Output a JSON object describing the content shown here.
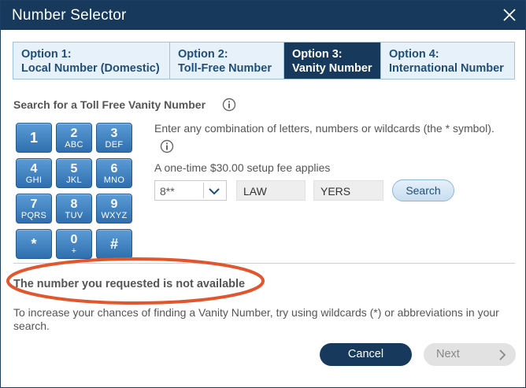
{
  "window": {
    "title": "Number Selector"
  },
  "tabs": [
    {
      "line1": "Option 1:",
      "line2": "Local Number (Domestic)",
      "active": false
    },
    {
      "line1": "Option 2:",
      "line2": "Toll-Free Number",
      "active": false
    },
    {
      "line1": "Option 3:",
      "line2": "Vanity Number",
      "active": true
    },
    {
      "line1": "Option 4:",
      "line2": "International Number",
      "active": false
    }
  ],
  "search": {
    "heading": "Search for a Toll Free Vanity Number",
    "instructions": "Enter any combination of letters, numbers or wildcards (the * symbol).",
    "fee": "A one-time $30.00 setup fee applies",
    "prefix_value": "8**",
    "field1_value": "LAW",
    "field2_value": "YERS",
    "button_label": "Search"
  },
  "keypad": [
    {
      "digit": "1",
      "letters": ""
    },
    {
      "digit": "2",
      "letters": "ABC"
    },
    {
      "digit": "3",
      "letters": "DEF"
    },
    {
      "digit": "4",
      "letters": "GHI"
    },
    {
      "digit": "5",
      "letters": "JKL"
    },
    {
      "digit": "6",
      "letters": "MNO"
    },
    {
      "digit": "7",
      "letters": "PQRS"
    },
    {
      "digit": "8",
      "letters": "TUV"
    },
    {
      "digit": "9",
      "letters": "WXYZ"
    },
    {
      "digit": "*",
      "letters": ""
    },
    {
      "digit": "0",
      "letters": "+"
    },
    {
      "digit": "#",
      "letters": ""
    }
  ],
  "result": {
    "message": "The number you requested is not available",
    "tip": "To increase your chances of finding a Vanity Number, try using wildcards (*) or abbreviations in your search."
  },
  "footer": {
    "cancel_label": "Cancel",
    "next_label": "Next"
  },
  "icons": {
    "close": "close-icon",
    "info": "info-icon",
    "dropdown": "chevron-down-icon",
    "next": "chevron-right-icon"
  },
  "colors": {
    "titlebar": "#173a5c",
    "key_blue": "#2f6fae",
    "annotation": "#e2552d",
    "tab_bg": "#e7f1f9"
  }
}
